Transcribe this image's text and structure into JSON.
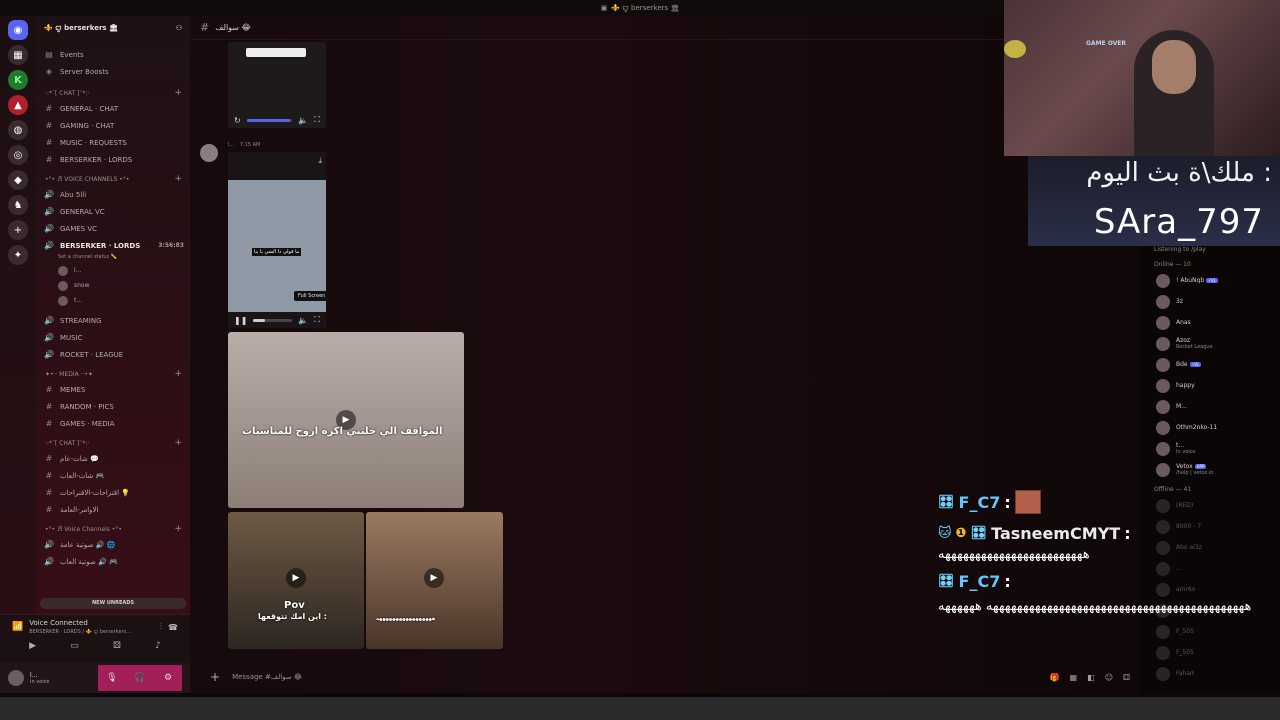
{
  "window": {
    "title": "⚜️ ꨄ berserkers 🏛"
  },
  "server": {
    "name": "⚜️ ꨄ berserkers 🏛"
  },
  "nav": {
    "events": "Events",
    "boosts": "Server Boosts"
  },
  "categories": {
    "chat": "·:*¨[ CHAT ]¨*:·",
    "voice": "•°• ♬ VOICE CHANNELS •°•",
    "media": "✦•·· MEDIA ··•✦",
    "chat_ar": "·:*¨[ CHAT ]¨*:·",
    "voice_ar": "•°• ♬ Voice Channels •°•"
  },
  "text_channels": [
    "GENERAL · CHAT",
    "GAMING · CHAT",
    "MUSIC · REQUESTS",
    "BERSERKER · LORDS"
  ],
  "voice_channels": {
    "ch1": "Abu 5lli",
    "ch2": "GENERAL VC",
    "ch3": "GAMES VC",
    "active": "BERSERKER · LORDS",
    "active_time": "3:56:83",
    "status_hint": "Set a channel status ✏️",
    "users": [
      "l...",
      "snow",
      "t..."
    ],
    "ch5": "STREAMING",
    "ch6": "MUSIC",
    "ch7": "ROCKET · LEAGUE"
  },
  "media_channels": [
    "MEMES",
    "RANDOM · PICS",
    "GAMES · MEDIA"
  ],
  "ar_channels": [
    "شات-عام 💬",
    "شات-العاب 🎮",
    "اقتراحات-الاقتراحات 💡",
    "الاوامر-العامة"
  ],
  "ar_voice": [
    "صوتية عامة 🔊 🌐",
    "صوتية العاب 🔊 🎮"
  ],
  "new_unreads": "NEW UNREADS",
  "voice_panel": {
    "title": "Voice Connected",
    "sub": "BERSERKER · LORDS / ⚜️ ꨄ berserkers..."
  },
  "user_panel": {
    "name": "l...",
    "status": "In voice"
  },
  "channel_header": {
    "name": "سوالف 😂"
  },
  "message": {
    "author": "l...",
    "time": "7:15 AM"
  },
  "media": {
    "tooltip": "Full Screen",
    "video2_caption": "ما قولي ذا الشي يا ينا",
    "large_caption": "المواقف الي خلتني اكره اروح للمناسبات",
    "thumb1_caption": "Pov",
    "thumb1_sub": "اين امك تتوقعها :",
    "thumb2_caption": "هههههههههههههههههه",
    "video1_progress": 0.95,
    "video2_progress": 0.3
  },
  "composer": {
    "placeholder": "Message #سوالف 😂"
  },
  "members": {
    "online_label": "Online — 10",
    "listening": "Listening to /play",
    "online": [
      {
        "name": "! AbuNqb",
        "badge": "⚡VL",
        "activity": ""
      },
      {
        "name": "3z",
        "badge": "",
        "activity": ""
      },
      {
        "name": "Anas",
        "badge": "",
        "activity": ""
      },
      {
        "name": "Azoz",
        "badge": "",
        "activity": "Rocket League"
      },
      {
        "name": "Bde",
        "badge": "⚡VL",
        "activity": ""
      },
      {
        "name": "happy",
        "badge": "",
        "activity": ""
      },
      {
        "name": "M...",
        "badge": "",
        "activity": ""
      },
      {
        "name": "Othm2nko-11",
        "badge": "",
        "activity": ""
      },
      {
        "name": "t...",
        "badge": "",
        "activity": "In voice"
      },
      {
        "name": "Vetox",
        "badge": "APP",
        "activity": "/help | vetox.io"
      }
    ],
    "offline_label": "Offline — 41",
    "offline": [
      "(RED)",
      "8000 - 7",
      "Abo al3z",
      "...",
      "amr6x",
      "...",
      "F_505",
      "F_505",
      "Fahad"
    ]
  },
  "stream_overlay": {
    "banner_ar": "ملك\\ة بث اليوم :",
    "banner_name": "SAra_797",
    "cam_sign": "GAME OVER",
    "chat": [
      {
        "user": "F_C7",
        "message": ""
      },
      {
        "user": "TasneemCMYT",
        "message": "ههههههههههههههههههههههههه"
      },
      {
        "user": "F_C7",
        "message": "هههههههههههههههههههههههههههههههههههههههههههه ههههههه"
      }
    ]
  },
  "colors": {
    "accent": "#5865f2",
    "brand_pink": "#a21f59",
    "online": "#3ba55c"
  }
}
